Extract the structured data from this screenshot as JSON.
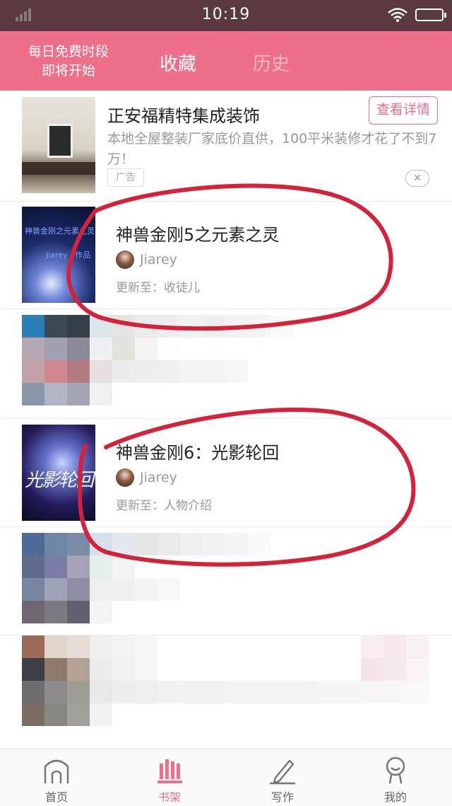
{
  "status_bar": {
    "time": "10:19"
  },
  "header": {
    "promo_line1": "每日免费时段",
    "promo_line2": "即将开始",
    "tabs": [
      {
        "label": "收藏",
        "active": true
      },
      {
        "label": "历史",
        "active": false
      }
    ]
  },
  "ad": {
    "title": "正安福精特集成装饰",
    "description": "本地全屋整装厂家底价直供，100平米装修才花了不到7万！",
    "button_label": "查看详情",
    "tag": "广告"
  },
  "books": [
    {
      "title": "神兽金刚5之元素之灵",
      "author": "Jiarey",
      "update_text": "更新至：收徒儿",
      "cover_text_line1": "神兽金刚之元素之灵",
      "cover_text_line2": "Jiarey / 作品"
    },
    {
      "title": "神兽金刚6：光影轮回",
      "author": "Jiarey",
      "update_text": "更新至：人物介绍",
      "cover_text": "光影轮回"
    }
  ],
  "bottom_nav": [
    {
      "label": "首页",
      "icon": "home-icon",
      "active": false
    },
    {
      "label": "书架",
      "icon": "bookshelf-icon",
      "active": true
    },
    {
      "label": "写作",
      "icon": "pen-icon",
      "active": false
    },
    {
      "label": "我的",
      "icon": "profile-icon",
      "active": false
    }
  ],
  "colors": {
    "brand_pink": "#ee6f8a",
    "status_bar": "#5a3a3e",
    "annotation_red": "#d3223a"
  }
}
